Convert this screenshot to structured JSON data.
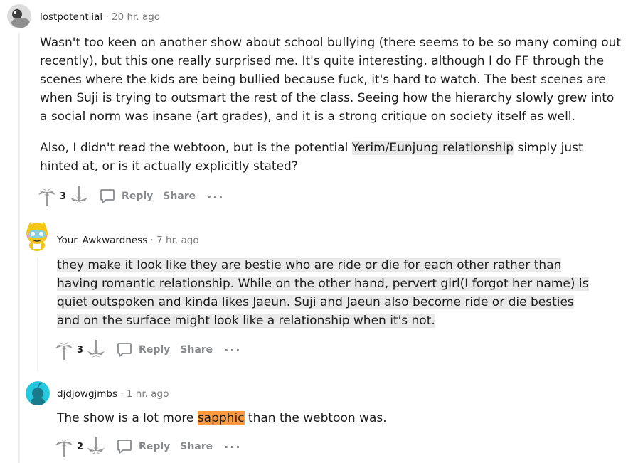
{
  "comments": [
    {
      "username": "lostpotentiial",
      "time": "20 hr. ago",
      "paragraph1": "Wasn't too keen on another show about school bullying (there seems to be so many coming out recently), but this one really surprised me. It's quite interesting, although I do FF through the scenes where the kids are being bullied because fuck, it's hard to watch. The best scenes are when Suji is trying to outsmart the rest of the class. Seeing how the hierarchy slowly grew into a social norm was insane (art grades), and it is a strong critique on society itself as well.",
      "p2_before": "Also, I didn't read the webtoon, but is the potential ",
      "p2_highlight": "Yerim/Eunjung relationship",
      "p2_after": " simply just hinted at, or is it actually explicitly stated?",
      "score": "3",
      "reply_label": "Reply",
      "share_label": "Share",
      "more_label": "···"
    },
    {
      "username": "Your_Awkwardness",
      "time": "7 hr. ago",
      "text": "they make it look like they are bestie who are ride or die for each other rather than having romantic relationship. While on the other hand, pervert girl(I forgot her name) is quiet outspoken and kinda likes Jaeun. Suji and Jaeun also become ride or die besties and on the surface might look like a relationship when it's not.",
      "score": "3",
      "reply_label": "Reply",
      "share_label": "Share",
      "more_label": "···"
    },
    {
      "username": "djdjowgjmbs",
      "time": "1 hr. ago",
      "text_before": "The show is a lot more ",
      "text_highlight": "sapphic",
      "text_after": " than the webtoon was.",
      "score": "2",
      "reply_label": "Reply",
      "share_label": "Share",
      "more_label": "···"
    }
  ],
  "separator": "·",
  "colors": {
    "grey_highlight": "#e9e9e9",
    "orange_highlight": "#ff9a3c",
    "meta": "#7c7c7c",
    "action": "#878a8c"
  }
}
